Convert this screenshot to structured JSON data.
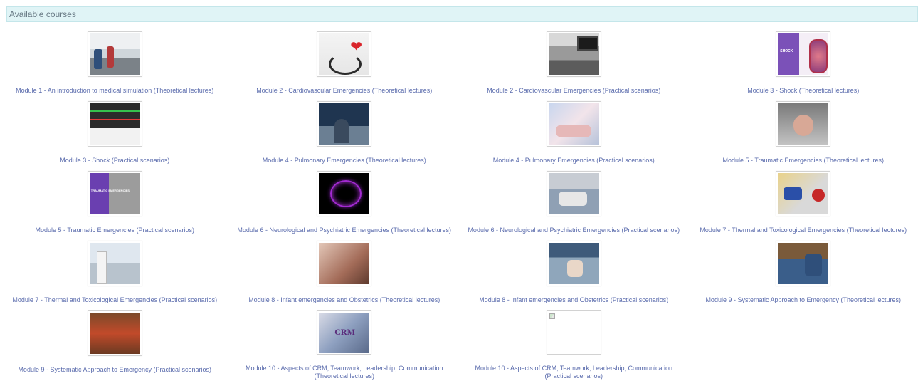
{
  "section": {
    "title": "Available courses"
  },
  "courses": [
    {
      "title": "Module 1 - An introduction to medical simulation (Theoretical lectures)",
      "image": "simulation-room-photo"
    },
    {
      "title": "Module 2 - Cardiovascular Emergencies (Theoretical lectures)",
      "image": "heart-stethoscope-photo"
    },
    {
      "title": "Module 2 - Cardiovascular Emergencies (Practical scenarios)",
      "image": "patient-monitor-photo"
    },
    {
      "title": "Module 3 - Shock (Theoretical lectures)",
      "image": "shock-banner-image",
      "image_text": "SHOCK"
    },
    {
      "title": "Module 3 - Shock (Practical scenarios)",
      "image": "monitor-screen-photo"
    },
    {
      "title": "Module 4 - Pulmonary Emergencies (Theoretical lectures)",
      "image": "pulmonary-xray-photo"
    },
    {
      "title": "Module 4 - Pulmonary Emergencies (Practical scenarios)",
      "image": "ventilation-photo"
    },
    {
      "title": "Module 5 - Traumatic Emergencies (Theoretical lectures)",
      "image": "abdominal-trauma-photo"
    },
    {
      "title": "Module 5 - Traumatic Emergencies (Practical scenarios)",
      "image": "trauma-banner-image",
      "image_text": "TRAUMATIC EMERGENCIES"
    },
    {
      "title": "Module 6 - Neurological and Psychiatric Emergencies (Theoretical lectures)",
      "image": "brain-illustration"
    },
    {
      "title": "Module 6 - Neurological and Psychiatric Emergencies (Practical scenarios)",
      "image": "ward-scenario-photo"
    },
    {
      "title": "Module 7 - Thermal and Toxicological Emergencies (Theoretical lectures)",
      "image": "toxicology-pills-photo"
    },
    {
      "title": "Module 7 - Thermal and Toxicological Emergencies (Practical scenarios)",
      "image": "lab-scenario-photo"
    },
    {
      "title": "Module 8 - Infant emergencies and Obstetrics (Theoretical lectures)",
      "image": "pregnancy-exam-photo"
    },
    {
      "title": "Module 8 - Infant emergencies and Obstetrics (Practical scenarios)",
      "image": "infant-care-photo"
    },
    {
      "title": "Module 9 - Systematic Approach to Emergency (Theoretical lectures)",
      "image": "team-approach-photo"
    },
    {
      "title": "Module 9 - Systematic Approach to Emergency (Practical scenarios)",
      "image": "emergency-scenario-photo"
    },
    {
      "title": "Module 10 - Aspects of CRM, Teamwork, Leadership, Communication (Theoretical lectures)",
      "image": "crm-team-photo",
      "image_text": "CRM"
    },
    {
      "title": "Module 10 - Aspects of CRM, Teamwork, Leadership, Communication (Practical scenarios)",
      "image": "broken-image"
    }
  ]
}
